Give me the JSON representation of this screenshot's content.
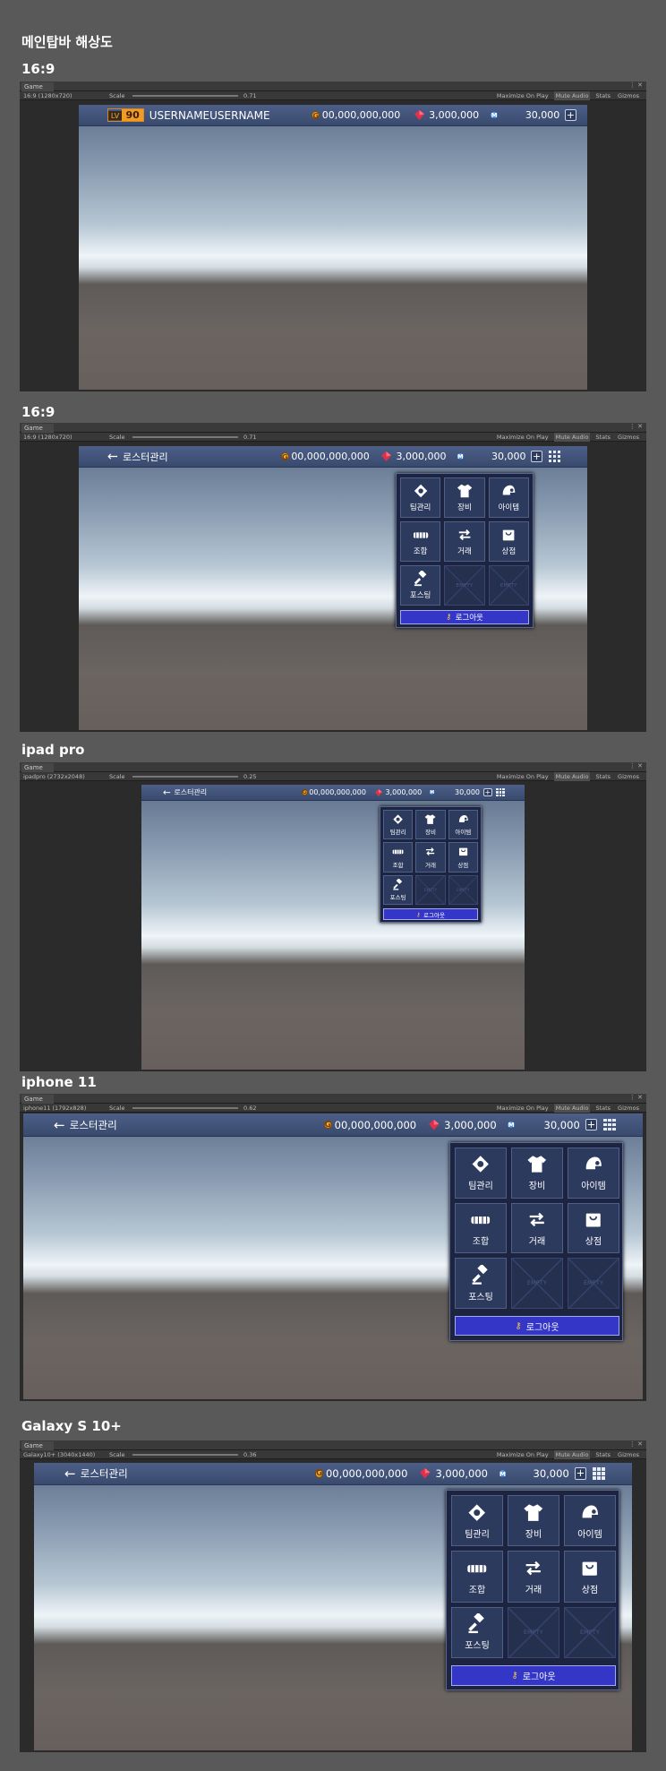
{
  "page": {
    "title": "메인탑바 해상도"
  },
  "common": {
    "tab_label": "Game",
    "scale_label": "Scale",
    "toolbar_options": [
      "Maximize On Play",
      "Mute Audio",
      "Stats",
      "Gizmos"
    ],
    "back_label": "로스터관리",
    "gold": "00,000,000,000",
    "ruby": "3,000,000",
    "mileage": "30,000",
    "coin_letter": "G",
    "mileage_letter": "M",
    "plus": "+",
    "menu_items": [
      {
        "label": "팀관리",
        "icon": "baseball-field-icon"
      },
      {
        "label": "장비",
        "icon": "uniform-shirt-icon"
      },
      {
        "label": "아이템",
        "icon": "helmet-icon"
      },
      {
        "label": "조합",
        "icon": "combine-bar-icon"
      },
      {
        "label": "거래",
        "icon": "trade-arrows-icon"
      },
      {
        "label": "상점",
        "icon": "shop-bag-icon"
      },
      {
        "label": "포스팅",
        "icon": "gavel-icon"
      }
    ],
    "empty_label": "EMPTY",
    "logout_label": "로그아웃",
    "colors": {
      "topbar": "#42547b",
      "popup": "#1d2440",
      "logout": "#3436c8",
      "accent_orange": "#f19a24"
    }
  },
  "sections": [
    {
      "heading": "16:9",
      "resolution": "16:9 (1280x720)",
      "scale_value": "0.71",
      "level_label": "LV",
      "level": "90",
      "username": "USERNAMEUSERNAME"
    },
    {
      "heading": "16:9",
      "resolution": "16:9 (1280x720)",
      "scale_value": "0.71"
    },
    {
      "heading": "ipad pro",
      "resolution": "ipadpro (2732x2048)",
      "scale_value": "0.25"
    },
    {
      "heading": "iphone 11",
      "resolution": "iphone11 (1792x828)",
      "scale_value": "0.62"
    },
    {
      "heading": "Galaxy  S 10+",
      "resolution": "Galaxy10+ (3040x1440)",
      "scale_value": "0.36"
    }
  ]
}
